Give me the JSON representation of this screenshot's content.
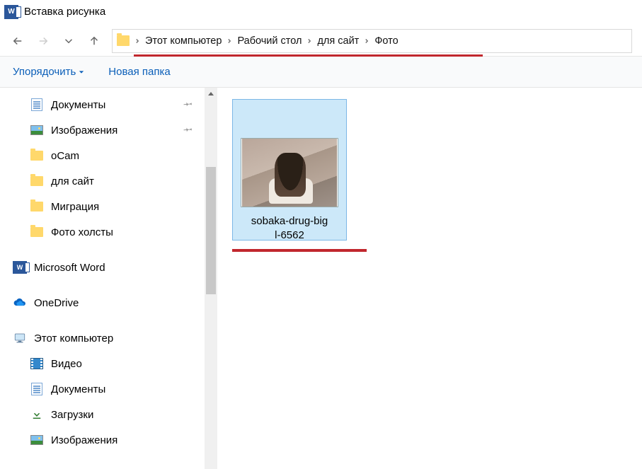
{
  "titlebar": {
    "title": "Вставка рисунка"
  },
  "nav": {
    "crumbs": [
      "Этот компьютер",
      "Рабочий стол",
      "для сайт",
      "Фото"
    ]
  },
  "toolbar": {
    "organize": "Упорядочить",
    "new_folder": "Новая папка"
  },
  "sidebar": {
    "items": [
      {
        "icon": "doc",
        "label": "Документы",
        "pinned": true,
        "depth": 1
      },
      {
        "icon": "img",
        "label": "Изображения",
        "pinned": true,
        "depth": 1
      },
      {
        "icon": "folder",
        "label": "oCam",
        "pinned": false,
        "depth": 1
      },
      {
        "icon": "folder",
        "label": "для сайт",
        "pinned": false,
        "depth": 1
      },
      {
        "icon": "folder",
        "label": "Миграция",
        "pinned": false,
        "depth": 1
      },
      {
        "icon": "folder",
        "label": "Фото холсты",
        "pinned": false,
        "depth": 1
      },
      {
        "gap": true
      },
      {
        "icon": "word",
        "label": "Microsoft Word",
        "pinned": false,
        "depth": 0
      },
      {
        "gap": true
      },
      {
        "icon": "onedrive",
        "label": "OneDrive",
        "pinned": false,
        "depth": 0
      },
      {
        "gap": true
      },
      {
        "icon": "pc",
        "label": "Этот компьютер",
        "pinned": false,
        "depth": 0
      },
      {
        "icon": "video",
        "label": "Видео",
        "pinned": false,
        "depth": 1
      },
      {
        "icon": "doc",
        "label": "Документы",
        "pinned": false,
        "depth": 1
      },
      {
        "icon": "dl",
        "label": "Загрузки",
        "pinned": false,
        "depth": 1
      },
      {
        "icon": "img",
        "label": "Изображения",
        "pinned": false,
        "depth": 1
      }
    ]
  },
  "content": {
    "file": {
      "name_line1": "sobaka-drug-big",
      "name_line2": "l-6562"
    }
  }
}
